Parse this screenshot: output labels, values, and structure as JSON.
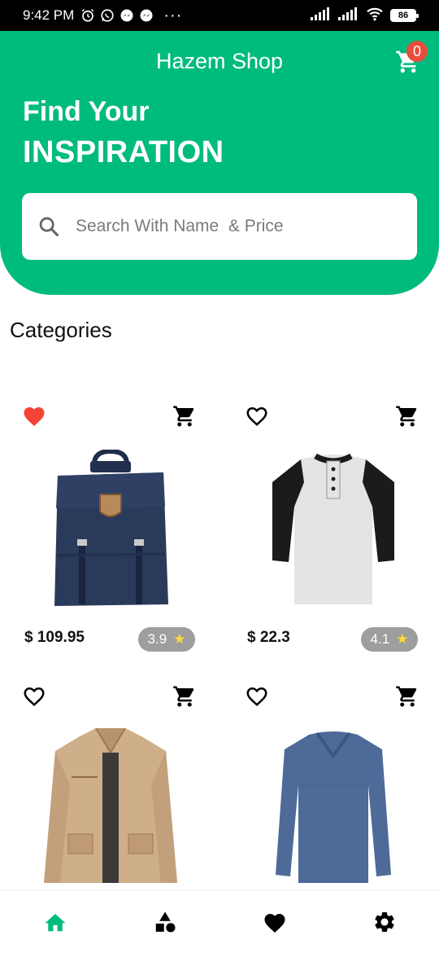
{
  "status_bar": {
    "time": "9:42 PM",
    "more": "···",
    "battery": "86"
  },
  "header": {
    "title": "Hazem Shop",
    "cart_count": "0",
    "headline_line1": "Find Your",
    "headline_line2": "INSPIRATION",
    "search_placeholder": "Search With Name  & Price"
  },
  "categories": {
    "title": "Categories"
  },
  "products": [
    {
      "price": "$ 109.95",
      "rating": "3.9",
      "favorite": true,
      "image": "backpack"
    },
    {
      "price": "$ 22.3",
      "rating": "4.1",
      "favorite": false,
      "image": "henley-shirt"
    },
    {
      "favorite": false,
      "image": "jacket"
    },
    {
      "favorite": false,
      "image": "long-sleeve-shirt"
    }
  ],
  "bottom_nav": [
    {
      "icon": "home-icon",
      "active": true
    },
    {
      "icon": "categories-icon",
      "active": false
    },
    {
      "icon": "favorites-icon",
      "active": false
    },
    {
      "icon": "settings-icon",
      "active": false
    }
  ],
  "colors": {
    "accent": "#00bb7e",
    "badge": "#e74c3c",
    "favorite": "#f44336",
    "rating_bg": "#9e9e9e",
    "star": "#ffd83b"
  }
}
